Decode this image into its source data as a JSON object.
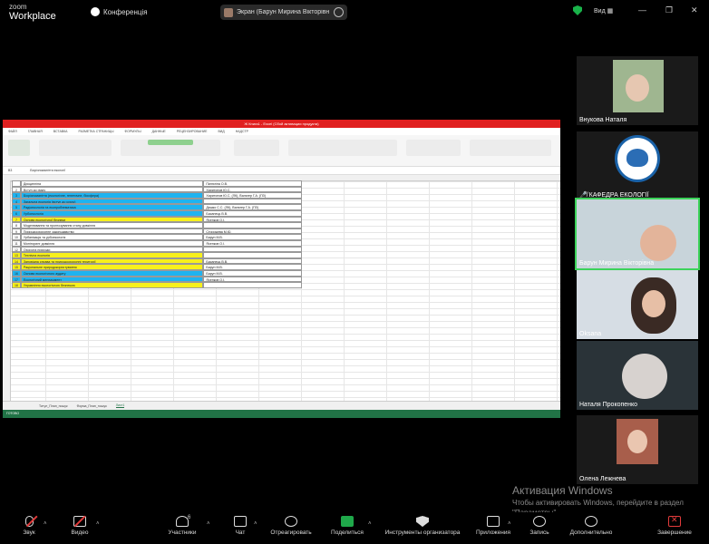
{
  "app": {
    "brand_top": "zoom",
    "brand_bottom": "Workplace",
    "conference_label": "Конференція"
  },
  "share_pill": {
    "text": "Экран (Барун Мирина Вікторівн"
  },
  "view_label": "Вид",
  "window_controls": [
    "—",
    "❐",
    "✕"
  ],
  "excel": {
    "title": "Ж Книга1 - Excel (Сбой активации продукта)",
    "menu": [
      "ФАЙЛ",
      "ГЛАВНАЯ",
      "ВСТАВКА",
      "РАЗМЕТКА СТРАНИЦЫ",
      "ФОРМУЛЫ",
      "ДАННЫЕ",
      "РЕЦЕНЗИРОВАНИЕ",
      "ВИД",
      "НАДСТР"
    ],
    "cell_ref": "B3",
    "formula": "Біорізноманіття екології",
    "rows": [
      {
        "num": "",
        "name": "Дисципліна",
        "teacher": "Пилюгіна О.В.",
        "color": "#ffffff"
      },
      {
        "num": "2",
        "name": "Вступ до фаху",
        "teacher": "Харитонов Ю.С.",
        "color": "#ffffff"
      },
      {
        "num": "3",
        "name": "Біорізноманіття (екологічне, генетичне, біосфера)",
        "teacher": "Харитонов Ю.С. (ЛК), Вальтер Г.А. (ПЗ)",
        "color": "#1fb3f0"
      },
      {
        "num": "4",
        "name": "Загальна екологія (вступ до курсу)",
        "teacher": "",
        "color": "#1fb3f0"
      },
      {
        "num": "5",
        "name": "Радіоекологія та екопроблематика",
        "teacher": "Дишко С.С. (ЛК), Вальтер Г.А. (ПЗ)",
        "color": "#1fb3f0"
      },
      {
        "num": "6",
        "name": "Урбоекологія",
        "teacher": "Басанець В.В.",
        "color": "#1fb3f0"
      },
      {
        "num": "7",
        "name": "Основи екологічної безпеки",
        "teacher": "Ясенков О.І.",
        "color": "#f7f01c"
      },
      {
        "num": "8",
        "name": "Моделювання та прогнозування стану довкілля",
        "teacher": "",
        "color": "#ffffff"
      },
      {
        "num": "9",
        "name": "Природоохоронне законодавство",
        "teacher": "Сторожева М.Ю.",
        "color": "#ffffff"
      },
      {
        "num": "10",
        "name": "Урбанізація та урбоекологія",
        "teacher": "Барун М.В.",
        "color": "#ffffff"
      },
      {
        "num": "11",
        "name": "Моніторинг довкілля",
        "teacher": "Ясенков О.І.",
        "color": "#ffffff"
      },
      {
        "num": "12",
        "name": "Охорона природи",
        "teacher": "",
        "color": "#ffffff"
      },
      {
        "num": "13",
        "name": "Технічна екологія",
        "teacher": "",
        "color": "#f7f01c"
      },
      {
        "num": "14",
        "name": "Заповідна справа та природоохоронні території",
        "teacher": "Басанець В.В.",
        "color": "#f7f01c"
      },
      {
        "num": "15",
        "name": "Раціональне природокористування",
        "teacher": "Барун М.В.",
        "color": "#f7f01c"
      },
      {
        "num": "16",
        "name": "Основи екологічного аудиту",
        "teacher": "Барун М.В.",
        "color": "#1fb3f0"
      },
      {
        "num": "17",
        "name": "Екологічний менеджмент",
        "teacher": "Ясенков О.І.",
        "color": "#1fb3f0"
      },
      {
        "num": "18",
        "name": "Управління екологічною безпекою",
        "teacher": "",
        "color": "#f7f01c"
      }
    ],
    "sheet_tabs": [
      "Титул_План_пошук",
      "Форма_План_пошук",
      "Лист1"
    ],
    "active_tab": "Лист1",
    "status": "ГОТОВО"
  },
  "participants": [
    {
      "name": "Внукова Наталя",
      "bg": "#9fb690"
    },
    {
      "name": "КАФЕДРА ЕКОЛОГІЇ",
      "bg": "#ffffff"
    },
    {
      "name": "Барун Мирина Вікторівна",
      "bg": "#c8d4da"
    },
    {
      "name": "Oksana",
      "bg": "#d6dde4"
    },
    {
      "name": "Наталя Прокопенко",
      "bg": "#6a7f8a"
    },
    {
      "name": "Олена Лежнева",
      "bg": "#a85e4b"
    }
  ],
  "activation": {
    "title": "Активация Windows",
    "body": "Чтобы активировать Windows, перейдите в раздел \"Параметры\"."
  },
  "toolbar": {
    "audio": "Звук",
    "video": "Видео",
    "participants": "Участники",
    "participants_count": "6",
    "chat": "Чат",
    "react": "Отреагировать",
    "share": "Поделиться",
    "host_tools": "Инструменты организатора",
    "apps": "Приложения",
    "record": "Запись",
    "more": "Дополнительно",
    "end": "Завершение"
  },
  "colors": {
    "highlight": "#3cd35a",
    "excel_green": "#217346",
    "end_red": "#e23b3b"
  }
}
